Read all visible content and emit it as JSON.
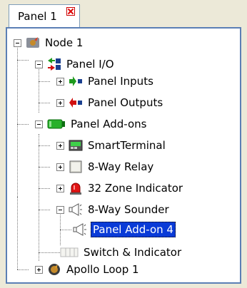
{
  "tab": {
    "label": "Panel 1"
  },
  "tree": {
    "node1": "Node 1",
    "panel_io": "Panel I/O",
    "panel_inputs": "Panel Inputs",
    "panel_outputs": "Panel Outputs",
    "panel_addons": "Panel Add-ons",
    "smartterminal": "SmartTerminal",
    "relay": "8-Way Relay",
    "zone": "32 Zone Indicator",
    "sounder": "8-Way Sounder",
    "addon4": "Panel Add-on 4",
    "switch": "Switch & Indicator",
    "apollo": "Apollo Loop 1"
  }
}
